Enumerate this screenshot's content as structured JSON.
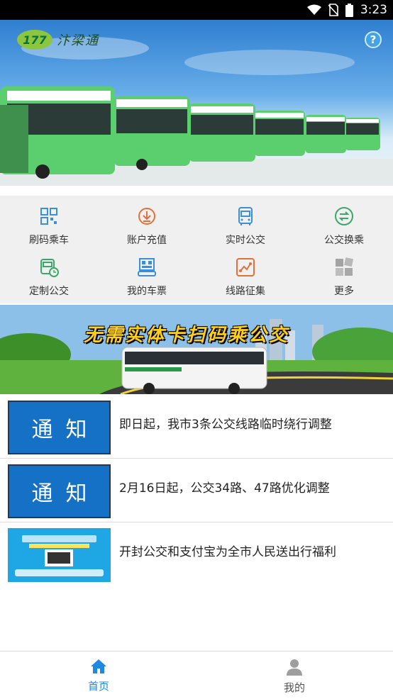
{
  "status_bar": {
    "time": "3:23",
    "icons": [
      "wifi-icon",
      "no-sim-icon",
      "battery-icon"
    ]
  },
  "app": {
    "logo_mark": "177",
    "name": "汴梁通",
    "help_label": "?"
  },
  "menu": [
    {
      "label": "刷码乘车",
      "icon": "qr-code-icon",
      "color": "#3a8fd9"
    },
    {
      "label": "账户充值",
      "icon": "download-circle-icon",
      "color": "#e2703a"
    },
    {
      "label": "实时公交",
      "icon": "bus-icon",
      "color": "#3a8fd9"
    },
    {
      "label": "公交换乘",
      "icon": "transfer-icon",
      "color": "#3aa866"
    },
    {
      "label": "定制公交",
      "icon": "custom-bus-clock-icon",
      "color": "#3aa866"
    },
    {
      "label": "我的车票",
      "icon": "ticket-qr-icon",
      "color": "#3a8fd9"
    },
    {
      "label": "线路征集",
      "icon": "route-map-icon",
      "color": "#e2703a"
    },
    {
      "label": "更多",
      "icon": "more-grid-icon",
      "color": "#9a9a9a"
    }
  ],
  "banner": {
    "text": "无需实体卡扫码乘公交"
  },
  "news": [
    {
      "thumb_text": "通知",
      "title": "即日起，我市3条公交线路临时绕行调整"
    },
    {
      "thumb_text": "通知",
      "title": "2月16日起，公交34路、47路优化调整"
    },
    {
      "thumb_text": "",
      "title": "开封公交和支付宝为全市人民送出行福利"
    }
  ],
  "tabs": [
    {
      "label": "首页",
      "icon": "home-icon",
      "active": true,
      "color": "#1e88e5"
    },
    {
      "label": "我的",
      "icon": "user-icon",
      "active": false,
      "color": "#555555"
    }
  ]
}
